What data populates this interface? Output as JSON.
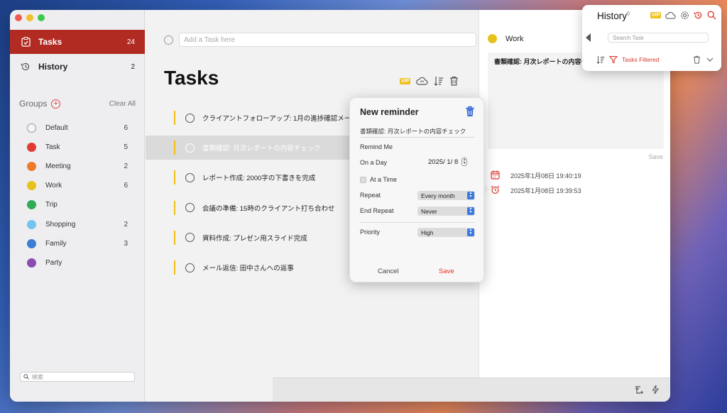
{
  "sidebar": {
    "nav": [
      {
        "label": "Tasks",
        "count": "24",
        "active": true
      },
      {
        "label": "History",
        "count": "2",
        "active": false
      }
    ],
    "groups_label": "Groups",
    "clear_all": "Clear All",
    "groups": [
      {
        "name": "Default",
        "count": "6",
        "color": "#f4f4f4"
      },
      {
        "name": "Task",
        "count": "5",
        "color": "#e23b33"
      },
      {
        "name": "Meeting",
        "count": "2",
        "color": "#ef7a2a"
      },
      {
        "name": "Work",
        "count": "6",
        "color": "#e8c21c"
      },
      {
        "name": "Trip",
        "count": "",
        "color": "#2eab55"
      },
      {
        "name": "Shopping",
        "count": "2",
        "color": "#74c4ee"
      },
      {
        "name": "Family",
        "count": "3",
        "color": "#3a7ed4"
      },
      {
        "name": "Party",
        "count": "",
        "color": "#8a4cb0"
      }
    ],
    "search_placeholder": "検索"
  },
  "main": {
    "add_placeholder": "Add a Task here",
    "title": "Tasks",
    "vip": "VIP",
    "tasks": [
      "クライアントフォローアップ: 1月の進捗確認メール送",
      "書類確認: 月次レポートの内容チェック",
      "レポート作成: 2000字の下書きを完成",
      "会議の準備: 15時のクライアント打ち合わせ",
      "資料作成: プレゼン用スライド完成",
      "メール返信: 田中さんへの返事"
    ]
  },
  "detail": {
    "group": "Work",
    "note": "書類確認: 月次レポートの内容チ",
    "save": "Save",
    "log": [
      {
        "time": "2025年1月08日 19:40:19",
        "icon": "calendar-icon"
      },
      {
        "time": "2025年1月08日 19:39:53",
        "icon": "alarm-icon"
      }
    ]
  },
  "reminder": {
    "title": "New reminder",
    "task": "書類確認: 月次レポートの内容チェック",
    "remind_me": "Remind Me",
    "on_a_day": "On a Day",
    "date": "2025/  1/  8",
    "at_a_time": "At a Time",
    "repeat_label": "Repeat",
    "repeat_value": "Every month",
    "end_repeat_label": "End Repeat",
    "end_repeat_value": "Never",
    "priority_label": "Priority",
    "priority_value": "High",
    "cancel": "Cancel",
    "save": "Save"
  },
  "history": {
    "title": "History",
    "badge": "0",
    "vip": "VIP",
    "search_placeholder": "Search Task",
    "filtered": "Tasks Filtered"
  }
}
